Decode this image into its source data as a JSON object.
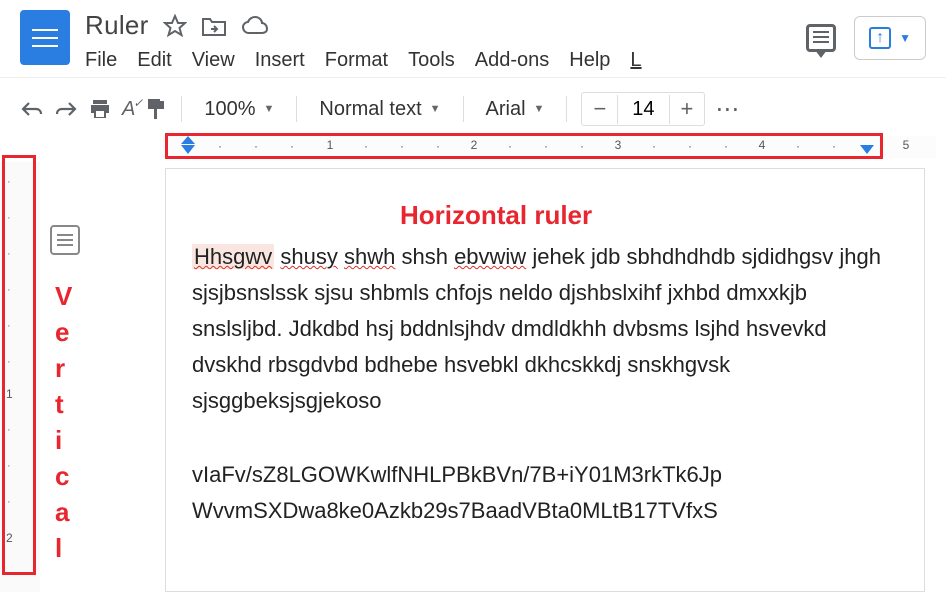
{
  "doc": {
    "title": "Ruler"
  },
  "menu": {
    "file": "File",
    "edit": "Edit",
    "view": "View",
    "insert": "Insert",
    "format": "Format",
    "tools": "Tools",
    "addons": "Add-ons",
    "help": "Help",
    "last": "L"
  },
  "toolbar": {
    "zoom": "100%",
    "style": "Normal text",
    "font": "Arial",
    "size": "14"
  },
  "annotations": {
    "horizontal": "Horizontal ruler",
    "vertical": "Vertical"
  },
  "ruler": {
    "h_numbers": [
      "1",
      "2",
      "3",
      "4",
      "5"
    ],
    "v_numbers": [
      "1",
      "2"
    ]
  },
  "content": {
    "p1_w1": "Hhsgwv",
    "p1_w2": "shusy",
    "p1_w3": "shwh",
    "p1_t1": " shsh ",
    "p1_w4": "ebvwiw",
    "p1_rest": " jehek jdb sbhdhdhdb sjdidhgsv jhgh sjsjbsnslssk sjsu shbmls chfojs neldo djshbslxihf jxhbd dmxxkjb snslsljbd. Jdkdbd hsj bddnlsjhdv dmdldkhh dvbsms lsjhd hsvevkd dvskhd rbsgdvbd bdhebe hsvebkl dkhcskkdj snskhgvsk sjsggbeksjsgjekoso",
    "p2": "vIaFv/sZ8LGOWKwlfNHLPBkBVn/7B+iY01M3rkTk6Jp WvvmSXDwa8ke0Azkb29s7BaadVBta0MLtB17TVfxS"
  }
}
